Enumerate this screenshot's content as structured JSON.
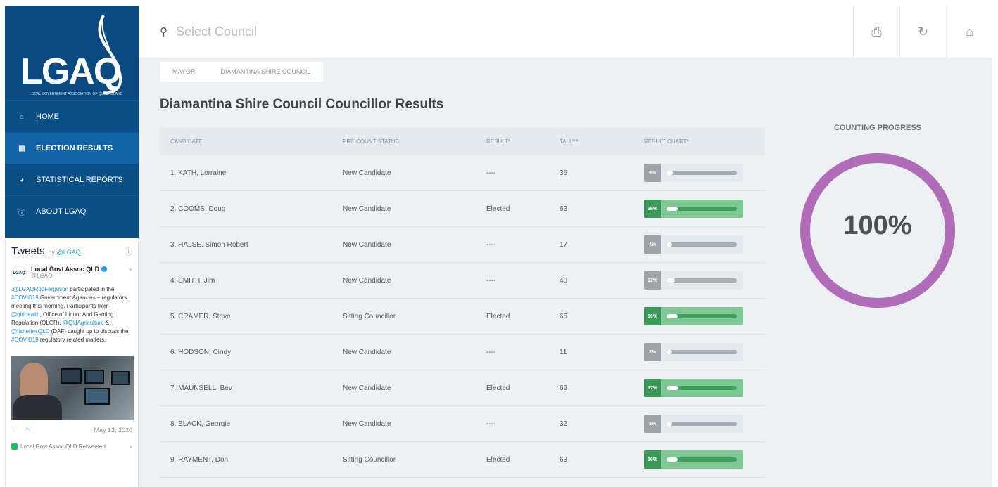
{
  "sidebar": {
    "logo": {
      "text": "LGAQ",
      "subtitle": "LOCAL GOVERNMENT ASSOCIATION OF QUEENSLAND"
    },
    "nav": [
      {
        "label": "HOME",
        "icon": "home-icon",
        "active": false
      },
      {
        "label": "ELECTION RESULTS",
        "icon": "bar-chart-icon",
        "active": true
      },
      {
        "label": "STATISTICAL REPORTS",
        "icon": "pie-chart-icon",
        "active": false
      },
      {
        "label": "ABOUT LGAQ",
        "icon": "info-icon",
        "active": false
      }
    ]
  },
  "tweets": {
    "title": "Tweets",
    "by": "by",
    "handle_link": "@LGAQ",
    "author_name": "Local Govt Assoc QLD",
    "author_handle": "@LGAQ",
    "text_parts": [
      {
        "t": ".@LGAQRobFerguson",
        "link": true
      },
      {
        "t": " participated in the ",
        "link": false
      },
      {
        "t": "#COVID19",
        "link": true
      },
      {
        "t": " Government Agencies – regulators meeting this morning. Participants from ",
        "link": false
      },
      {
        "t": "@qldhealth",
        "link": true
      },
      {
        "t": ", Office of Liquor And Gaming Regulation (OLGR), ",
        "link": false
      },
      {
        "t": "@QldAgriculture",
        "link": true
      },
      {
        "t": " & ",
        "link": false
      },
      {
        "t": "@fisheriesQLD",
        "link": true
      },
      {
        "t": " (DAF) caught up to discuss the ",
        "link": false
      },
      {
        "t": "#COVID19",
        "link": true
      },
      {
        "t": " regulatory related matters.",
        "link": false
      }
    ],
    "date": "May 13, 2020",
    "retweet_label": "Local Govt Assoc QLD Retweeted"
  },
  "topbar": {
    "search_placeholder": "Select Council",
    "buttons": [
      "print-icon",
      "refresh-icon",
      "home-icon"
    ]
  },
  "breadcrumb": [
    "MAYOR",
    "DIAMANTINA SHIRE COUNCIL"
  ],
  "main": {
    "title": "Diamantina Shire Council Councillor Results",
    "columns": [
      "CANDIDATE",
      "PRE-COUNT STATUS",
      "RESULT*",
      "TALLY*",
      "RESULT CHART*"
    ],
    "rows": [
      {
        "candidate": "1. KATH, Lorraine",
        "status": "New Candidate",
        "result": "----",
        "tally": "36",
        "pct_label": "9%",
        "pct": 9,
        "elected": false
      },
      {
        "candidate": "2. COOMS, Doug",
        "status": "New Candidate",
        "result": "Elected",
        "tally": "63",
        "pct_label": "16%",
        "pct": 16,
        "elected": true
      },
      {
        "candidate": "3. HALSE, Simon Robert",
        "status": "New Candidate",
        "result": "----",
        "tally": "17",
        "pct_label": "4%",
        "pct": 4,
        "elected": false
      },
      {
        "candidate": "4. SMITH, Jim",
        "status": "New Candidate",
        "result": "----",
        "tally": "48",
        "pct_label": "12%",
        "pct": 12,
        "elected": false
      },
      {
        "candidate": "5. CRAMER, Steve",
        "status": "Sitting Councillor",
        "result": "Elected",
        "tally": "65",
        "pct_label": "16%",
        "pct": 16,
        "elected": true
      },
      {
        "candidate": "6. HODSON, Cindy",
        "status": "New Candidate",
        "result": "----",
        "tally": "11",
        "pct_label": "3%",
        "pct": 3,
        "elected": false
      },
      {
        "candidate": "7. MAUNSELL, Bev",
        "status": "New Candidate",
        "result": "Elected",
        "tally": "69",
        "pct_label": "17%",
        "pct": 17,
        "elected": true
      },
      {
        "candidate": "8. BLACK, Georgie",
        "status": "New Candidate",
        "result": "----",
        "tally": "32",
        "pct_label": "8%",
        "pct": 8,
        "elected": false
      },
      {
        "candidate": "9. RAYMENT, Don",
        "status": "Sitting Councillor",
        "result": "Elected",
        "tally": "63",
        "pct_label": "16%",
        "pct": 16,
        "elected": true
      }
    ]
  },
  "progress": {
    "label": "COUNTING PROGRESS",
    "value_label": "100%",
    "value": 100,
    "ring_color": "#b06bb9"
  },
  "colors": {
    "sidebar": "#0b4f87",
    "elected_bar": "#7ec993",
    "elected_pct": "#3b9a5a"
  }
}
